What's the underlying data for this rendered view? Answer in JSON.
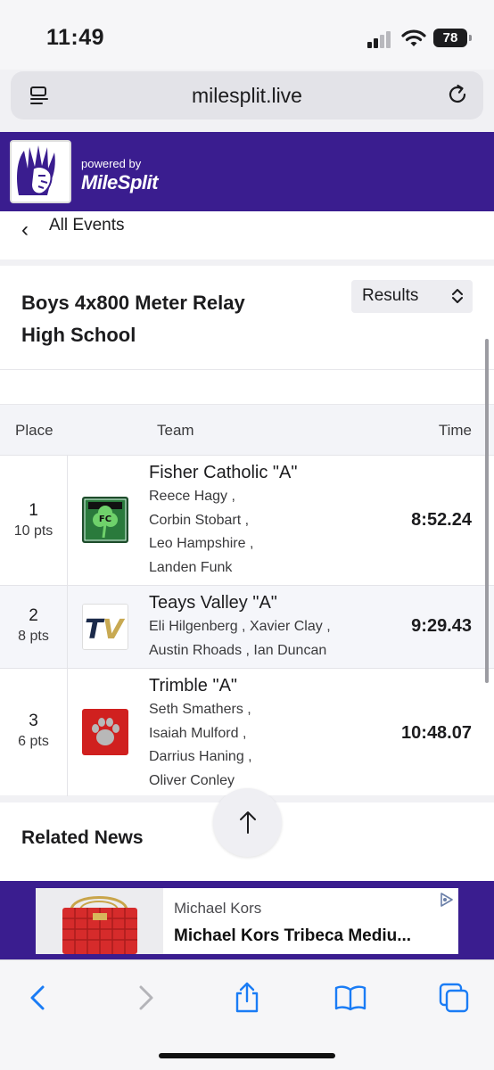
{
  "status_bar": {
    "time": "11:49",
    "battery": "78"
  },
  "browser": {
    "url": "milesplit.live"
  },
  "header": {
    "powered_by": "powered by",
    "brand": "MileSplit"
  },
  "nav": {
    "back_label": "All Events"
  },
  "event": {
    "title_line1": "Boys 4x800 Meter Relay",
    "title_line2": "High School",
    "view_select": "Results"
  },
  "table": {
    "headers": {
      "place": "Place",
      "team": "Team",
      "time": "Time"
    },
    "rows": [
      {
        "place": "1",
        "points": "10 pts",
        "team": "Fisher Catholic \"A\"",
        "athletes": [
          "Reece Hagy ,",
          "Corbin Stobart ,",
          "Leo Hampshire ,",
          "Landen Funk"
        ],
        "time": "8:52.24",
        "logo": "shamrock-logo"
      },
      {
        "place": "2",
        "points": "8 pts",
        "team": "Teays Valley \"A\"",
        "athletes": [
          "Eli Hilgenberg ,  Xavier Clay ,",
          "Austin Rhoads ,  Ian Duncan"
        ],
        "time": "9:29.43",
        "logo": "tv-logo"
      },
      {
        "place": "3",
        "points": "6 pts",
        "team": "Trimble \"A\"",
        "athletes": [
          "Seth Smathers ,",
          "Isaiah Mulford ,",
          "Darrius Haning ,",
          "Oliver Conley"
        ],
        "time": "10:48.07",
        "logo": "paw-logo"
      }
    ]
  },
  "related_news": {
    "title": "Related News"
  },
  "ad": {
    "brand": "Michael Kors",
    "title": "Michael Kors Tribeca Mediu..."
  },
  "colors": {
    "header_purple": "#3a1d8f",
    "ios_blue": "#1a7cf5"
  }
}
